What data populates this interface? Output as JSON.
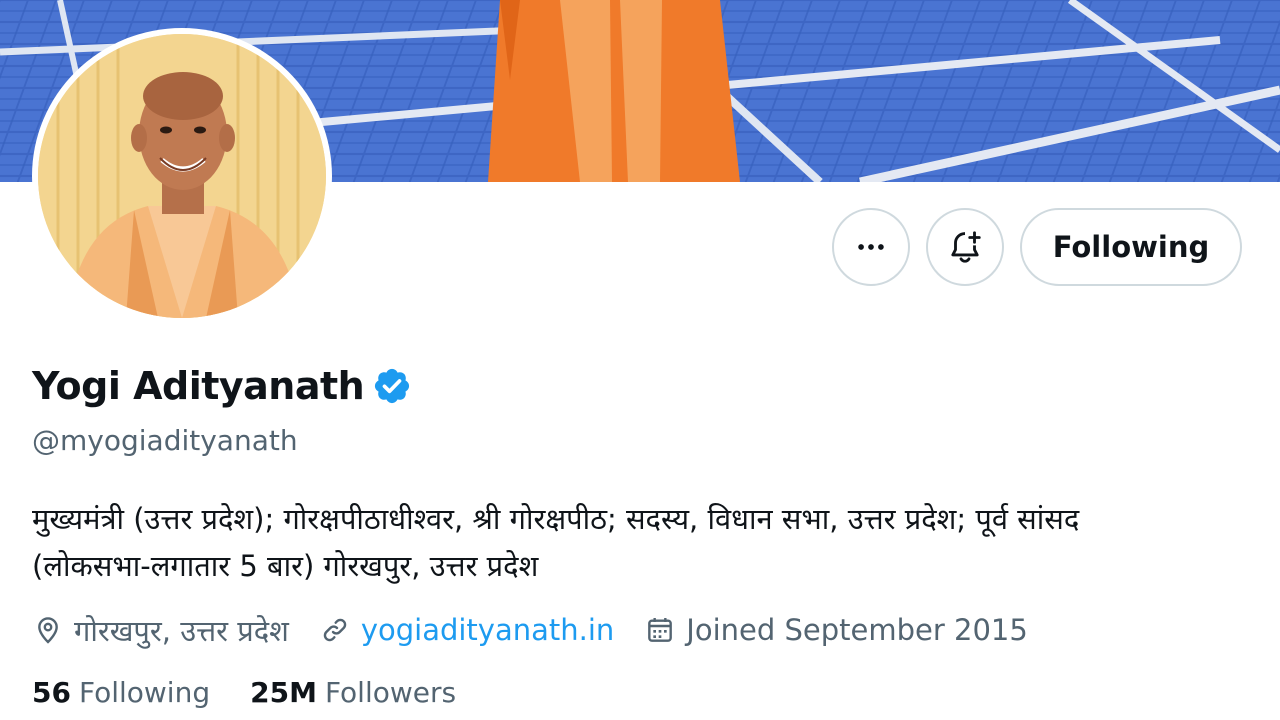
{
  "profile": {
    "display_name": "Yogi Adityanath",
    "handle": "@myogiadityanath",
    "bio_line1": "मुख्यमंत्री (उत्तर प्रदेश); गोरक्षपीठाधीश्वर, श्री गोरक्षपीठ; सदस्य, विधान सभा, उत्तर प्रदेश; पूर्व सांसद",
    "bio_line2": "(लोकसभा-लगातार 5 बार) गोरखपुर, उत्तर प्रदेश",
    "location": "गोरखपुर, उत्तर प्रदेश",
    "website": "yogiadityanath.in",
    "joined": "Joined September 2015"
  },
  "actions": {
    "more_icon": "more-horizontal-icon",
    "notify_icon": "bell-plus-icon",
    "following_label": "Following"
  },
  "stats": {
    "following_count": "56",
    "following_label": "Following",
    "followers_count": "25M",
    "followers_label": "Followers"
  },
  "colors": {
    "accent": "#1d9bf0",
    "secondary_text": "#536471",
    "border": "#cfd9de",
    "verified": "#1d9bf0"
  }
}
